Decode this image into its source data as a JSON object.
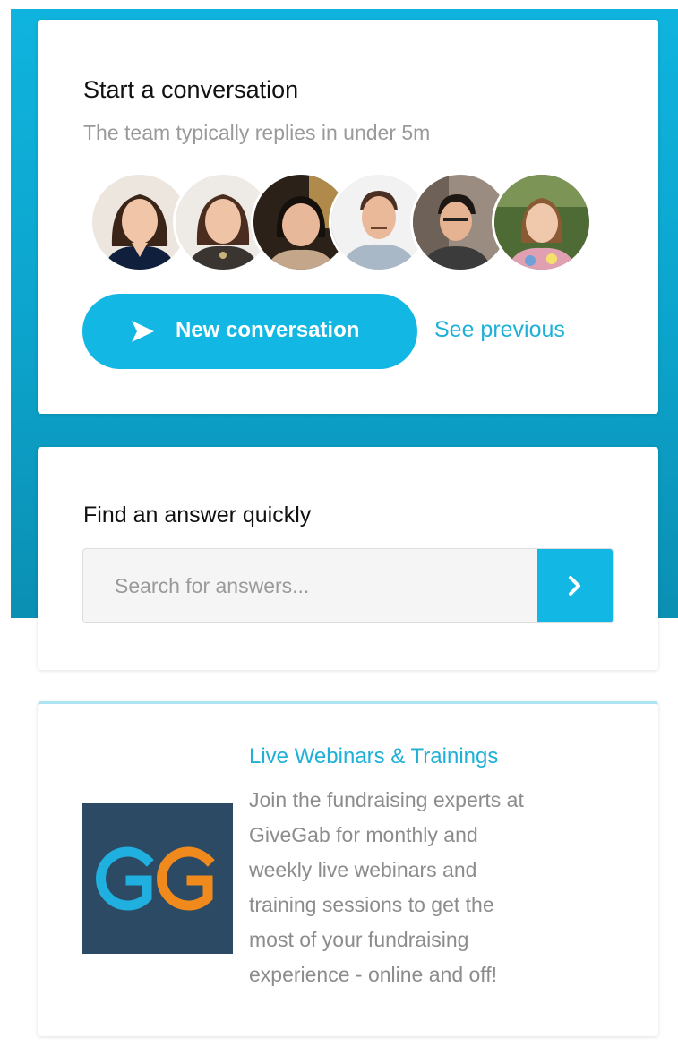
{
  "conversation": {
    "title": "Start a conversation",
    "subtitle": "The team typically replies in under 5m",
    "team_avatars": [
      "avatar-woman-dark-hair",
      "avatar-woman-brown-hair",
      "avatar-woman-short-hair",
      "avatar-man-mustache",
      "avatar-man-glasses",
      "avatar-woman-outdoors"
    ],
    "new_button_label": "New conversation",
    "new_button_icon": "send-icon",
    "see_previous_label": "See previous"
  },
  "search": {
    "title": "Find an answer quickly",
    "placeholder": "Search for answers...",
    "submit_icon": "chevron-right-icon"
  },
  "article": {
    "logo_text": "GG",
    "title": "Live Webinars & Trainings",
    "body": "Join the fundraising experts at\nGiveGab for monthly and\nweekly live webinars and\ntraining sessions to get the\nmost of your fundraising\nexperience - online and off!"
  },
  "colors": {
    "accent": "#13b7e3",
    "hero_background": "#0ca3cb",
    "logo_background": "#2c4a63",
    "logo_blue": "#1fb0e0",
    "logo_orange": "#f08a1c"
  }
}
